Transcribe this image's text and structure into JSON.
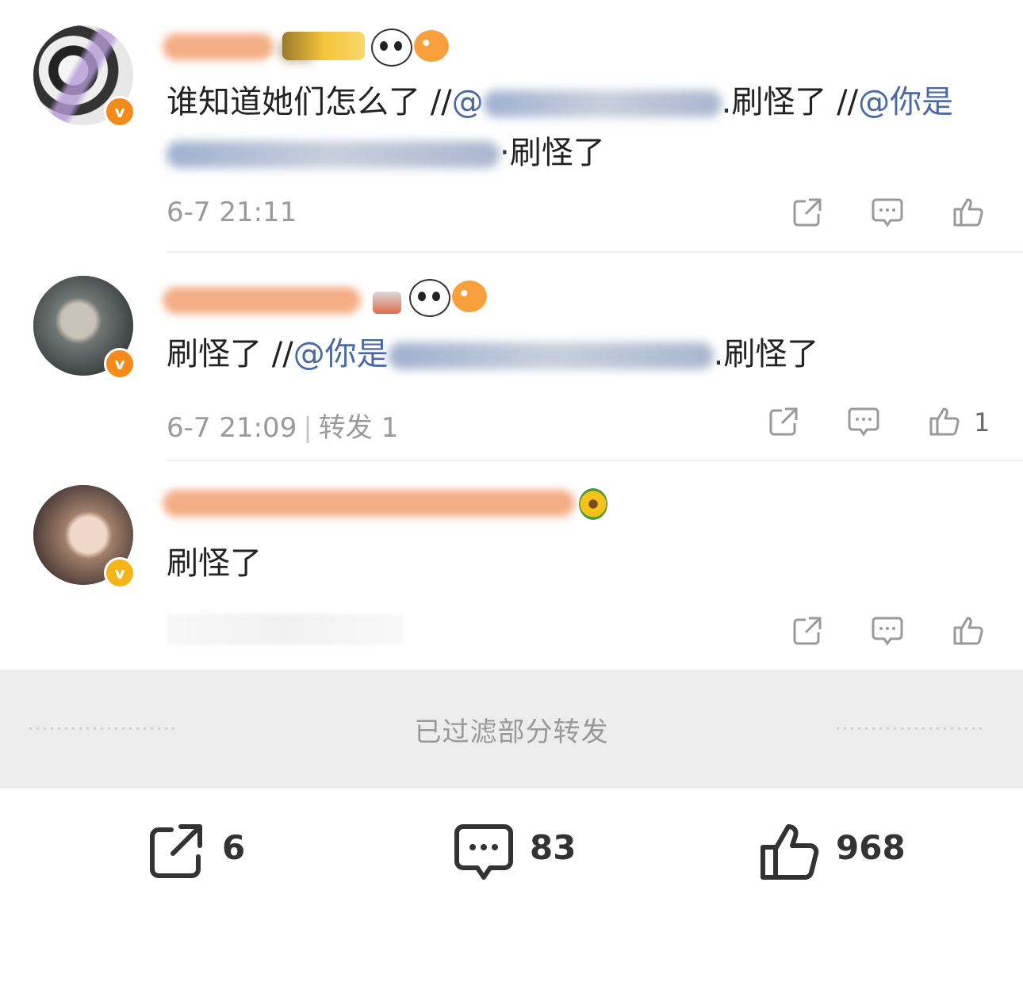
{
  "comments": [
    {
      "content_pre": "谁知道她们怎么了 //",
      "mention_1": "@",
      "content_mid": ".刷怪了 //",
      "mention_2": "@你是",
      "content_line2_end": "·刷怪了",
      "time": "6-7 21:11"
    },
    {
      "content_pre": "刷怪了 //",
      "mention_1": "@你是",
      "content_end": ".刷怪了",
      "time": "6-7 21:09",
      "meta_divider": "|",
      "repost_label": "转发 1",
      "like_count": "1"
    },
    {
      "content": "刷怪了"
    }
  ],
  "filter_notice": "已过滤部分转发",
  "bottom_bar": {
    "repost_count": "6",
    "comment_count": "83",
    "like_count": "968"
  },
  "colors": {
    "accent_orange": "#f28a1c",
    "mention_blue": "#4a6aa5",
    "meta_gray": "#9a9a9a"
  }
}
